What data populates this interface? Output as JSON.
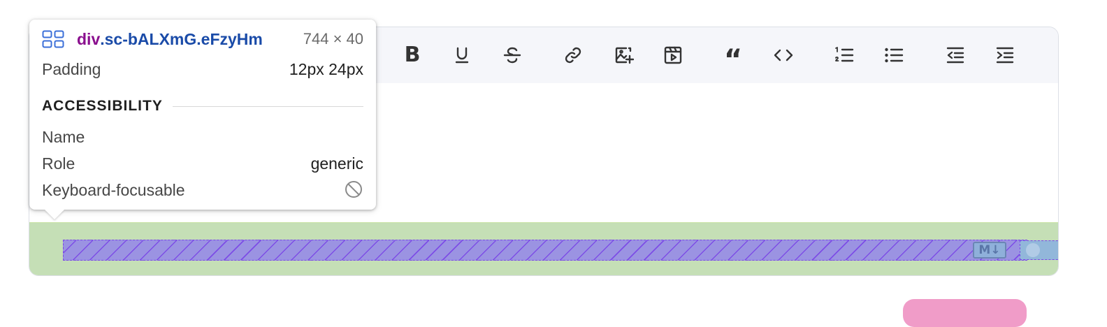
{
  "toolbar": {
    "buttons": [
      {
        "name": "bold-icon",
        "label": "B"
      },
      {
        "name": "underline-icon",
        "label": "U"
      },
      {
        "name": "strikethrough-icon",
        "label": "S"
      },
      {
        "name": "link-icon"
      },
      {
        "name": "image-add-icon"
      },
      {
        "name": "video-icon"
      },
      {
        "name": "blockquote-icon"
      },
      {
        "name": "code-icon"
      },
      {
        "name": "ordered-list-icon"
      },
      {
        "name": "bullet-list-icon"
      },
      {
        "name": "outdent-icon"
      },
      {
        "name": "indent-icon"
      }
    ]
  },
  "footer": {
    "markdown_badge": "M↓",
    "toggle_on": false
  },
  "tooltip": {
    "tag": "div",
    "class_name": ".sc-bALXmG.eFzyHm",
    "size": "744 × 40",
    "padding_label": "Padding",
    "padding_value": "12px 24px",
    "section_title": "ACCESSIBILITY",
    "name_label": "Name",
    "name_value": "",
    "role_label": "Role",
    "role_value": "generic",
    "focusable_label": "Keyboard-focusable",
    "focusable_icon": "not-allowed-icon"
  },
  "colors": {
    "footer_highlight": "#c5dfb6",
    "content_highlight": "#9b93e2",
    "primary_button": "#f09cc8"
  }
}
